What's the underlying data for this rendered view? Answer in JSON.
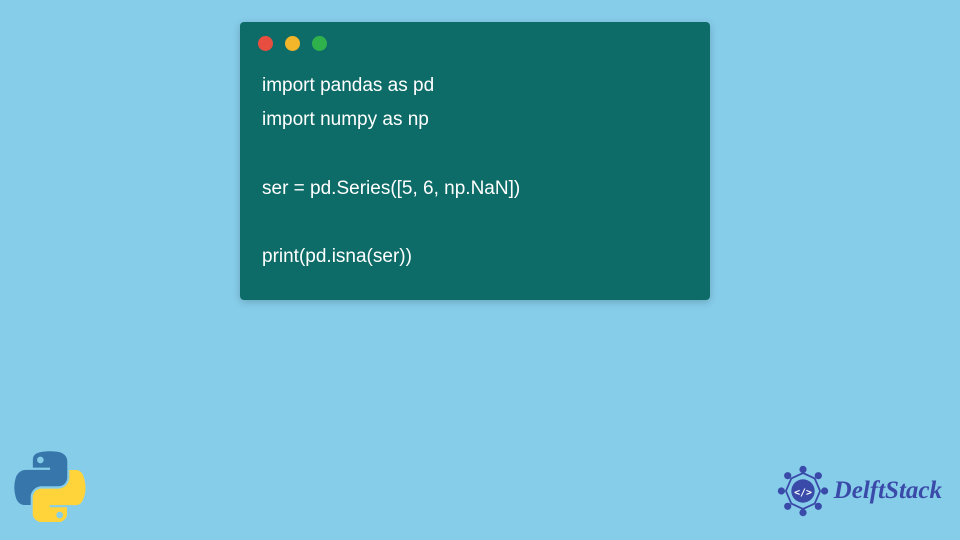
{
  "code": {
    "line1": "import pandas as pd",
    "line2": "import numpy as np",
    "line3": "",
    "line4": "ser = pd.Series([5, 6, np.NaN])",
    "line5": "",
    "line6": "print(pd.isna(ser))"
  },
  "branding": {
    "delftstack_text": "DelftStack"
  },
  "colors": {
    "background": "#86cdea",
    "code_bg": "#0e6c68",
    "code_text": "#ffffff",
    "delftstack_blue": "#3a4aa8"
  }
}
